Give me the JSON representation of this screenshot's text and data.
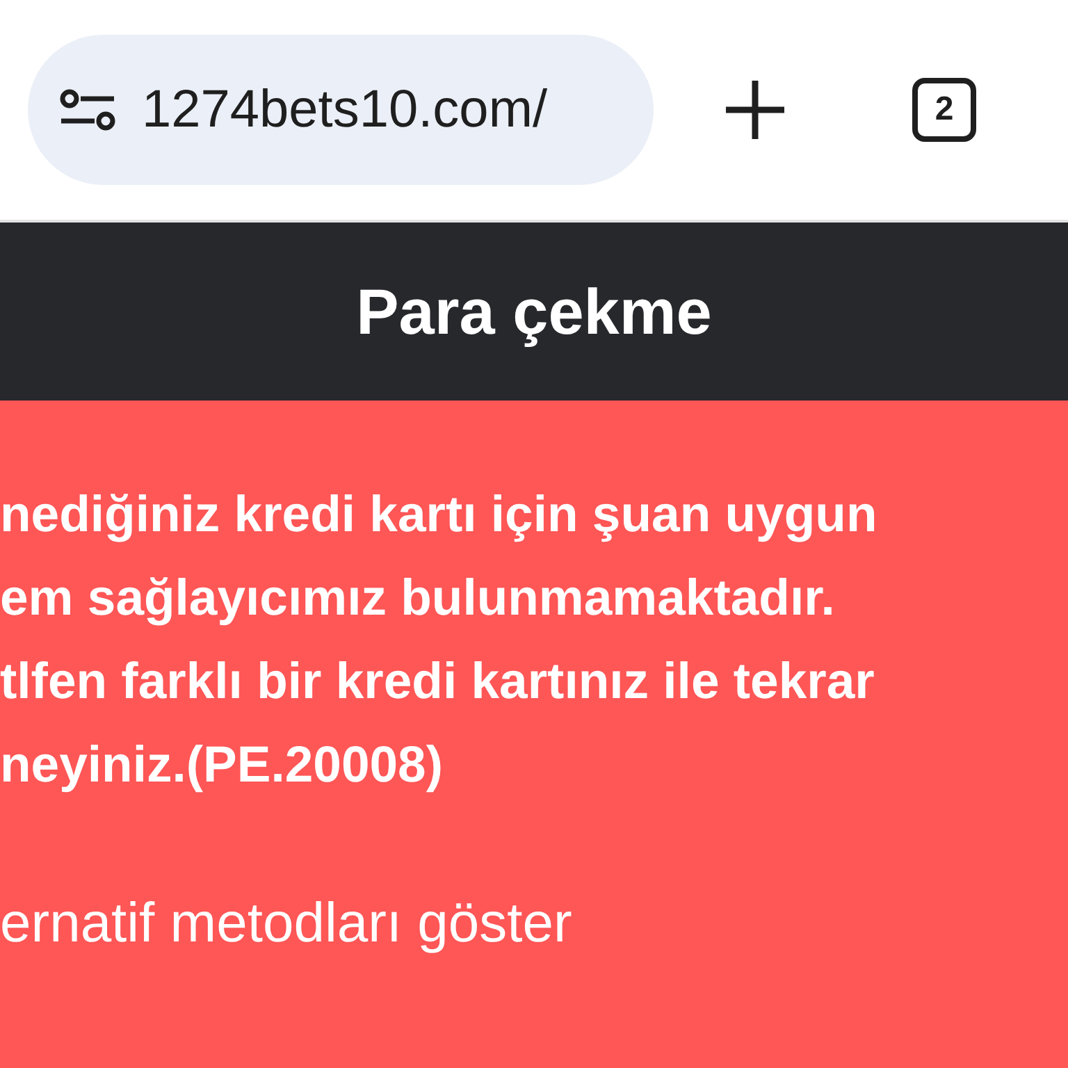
{
  "browser": {
    "url": "1274bets10.com/",
    "tab_count": "2"
  },
  "header": {
    "title": "Para çekme"
  },
  "alert": {
    "message_lines": [
      "nediğiniz kredi kartı için şuan uygun",
      "em sağlayıcımız bulunmamaktadır.",
      "tlfen farklı bir kredi kartınız ile tekrar",
      "neyiniz.(PE.20008)"
    ],
    "link": "ernatif metodları göster"
  }
}
